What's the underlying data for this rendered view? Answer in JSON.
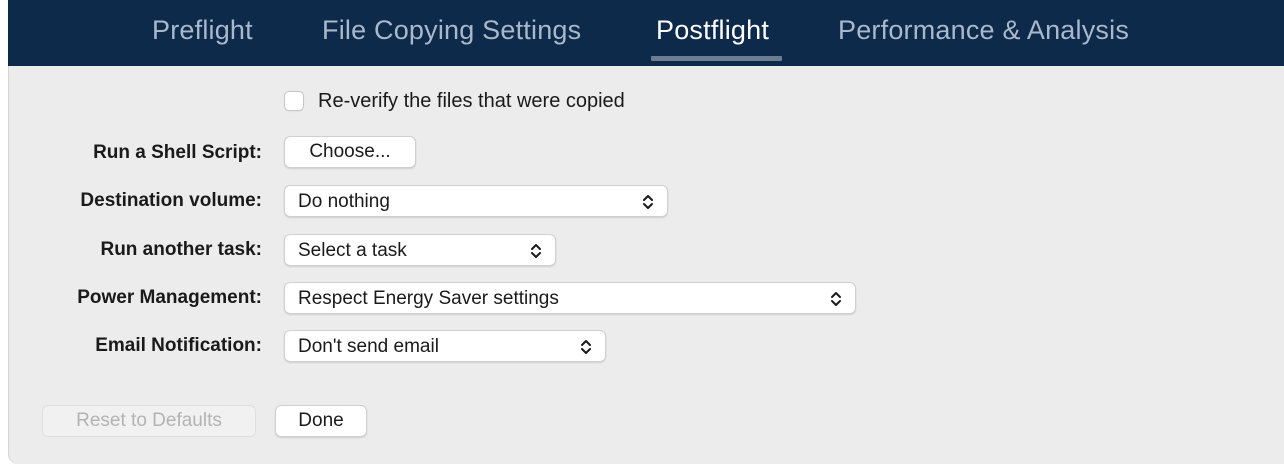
{
  "tabs": [
    {
      "label": "Preflight",
      "active": false
    },
    {
      "label": "File Copying Settings",
      "active": false
    },
    {
      "label": "Postflight",
      "active": true
    },
    {
      "label": "Performance & Analysis",
      "active": false
    }
  ],
  "reverify": {
    "label": "Re-verify the files that were copied",
    "checked": false
  },
  "shell_script": {
    "label": "Run a Shell Script:",
    "button": "Choose..."
  },
  "destination_volume": {
    "label": "Destination volume:",
    "value": "Do nothing"
  },
  "another_task": {
    "label": "Run another task:",
    "value": "Select a task"
  },
  "power_management": {
    "label": "Power Management:",
    "value": "Respect Energy Saver settings"
  },
  "email_notification": {
    "label": "Email Notification:",
    "value": "Don't send email"
  },
  "footer": {
    "reset_label": "Reset to Defaults",
    "done_label": "Done"
  },
  "icons": {
    "popup_arrows": "chevron-up-down-icon"
  },
  "colors": {
    "tabbar_bg": "#0e2a4a",
    "tab_active": "#ffffff",
    "tab_inactive": "#a9b8cb",
    "panel_bg": "#ececec"
  }
}
